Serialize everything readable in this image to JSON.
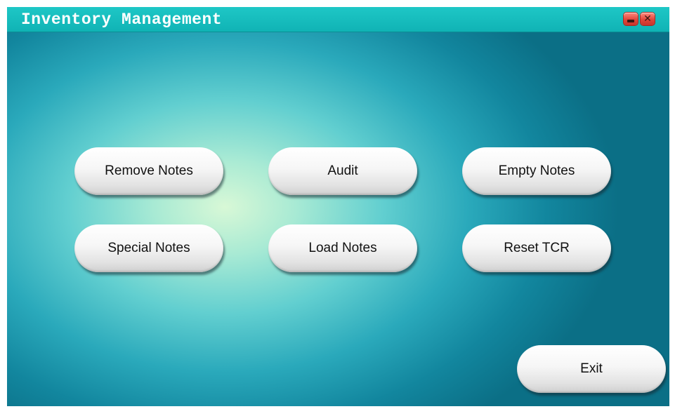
{
  "window": {
    "title": "Inventory Management",
    "controls": {
      "minimize_icon": "minimize-icon",
      "close_icon": "close-icon",
      "close_glyph": "✕"
    }
  },
  "buttons": {
    "remove_notes": "Remove Notes",
    "audit": "Audit",
    "empty_notes": "Empty Notes",
    "special_notes": "Special Notes",
    "load_notes": "Load Notes",
    "reset_tcr": "Reset TCR",
    "exit": "Exit"
  },
  "colors": {
    "titlebar": "#10b3b5",
    "background_center": "#d8f8d6",
    "background_edge": "#0b6f86",
    "window_control": "#e0453a",
    "button_face": "#f6f6f6"
  }
}
